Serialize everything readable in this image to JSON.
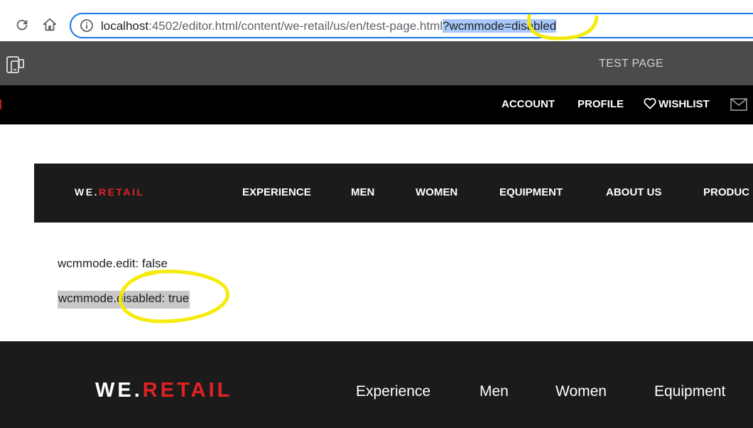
{
  "browser": {
    "url_host": "localhost",
    "url_path": ":4502/editor.html/content/we-retail/us/en/test-page.html",
    "url_selected": "?wcmmode=disabled",
    "icons": {
      "reload": "reload-icon",
      "home": "home-icon",
      "info": "info-icon"
    }
  },
  "editor": {
    "title": "TEST PAGE",
    "icons": {
      "device": "device-preview-icon"
    }
  },
  "top_nav": {
    "account": "ACCOUNT",
    "profile": "PROFILE",
    "wishlist": "WISHLIST",
    "icons": {
      "wishlist": "heart-icon",
      "mail": "mail-icon"
    }
  },
  "brand": {
    "prefix": "WE.",
    "suffix": "RETAIL",
    "accent_color": "#e02222"
  },
  "main_nav": {
    "items": [
      "EXPERIENCE",
      "MEN",
      "WOMEN",
      "EQUIPMENT",
      "ABOUT US",
      "PRODUC"
    ]
  },
  "content": {
    "edit_line": "wcmmode.edit: false",
    "disabled_line": "wcmmode.disabled: true"
  },
  "footer": {
    "links": [
      "Experience",
      "Men",
      "Women",
      "Equipment"
    ]
  },
  "colors": {
    "address_border": "#1a73e8",
    "selection": "#a8c7fa",
    "editor_bar": "#4b4b4b",
    "nav_dark": "#1b1b1b",
    "highlight_marker": "#f5ea00"
  }
}
